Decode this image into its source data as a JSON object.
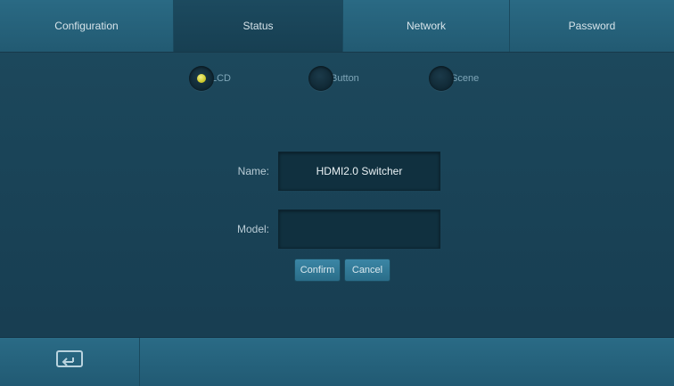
{
  "tabs": [
    {
      "label": "Configuration",
      "active": false
    },
    {
      "label": "Status",
      "active": true
    },
    {
      "label": "Network",
      "active": false
    },
    {
      "label": "Password",
      "active": false
    }
  ],
  "mode_options": [
    {
      "label": "LCD",
      "selected": true
    },
    {
      "label": "Button",
      "selected": false
    },
    {
      "label": "Scene",
      "selected": false
    }
  ],
  "form": {
    "name_label": "Name:",
    "name_value": "HDMI2.0 Switcher",
    "model_label": "Model:",
    "model_value": ""
  },
  "buttons": {
    "confirm": "Confirm",
    "cancel": "Cancel"
  },
  "footer": {
    "icon": "return-icon"
  },
  "colors": {
    "accent_selected": "#d8d53a",
    "background": "#1a4458"
  }
}
